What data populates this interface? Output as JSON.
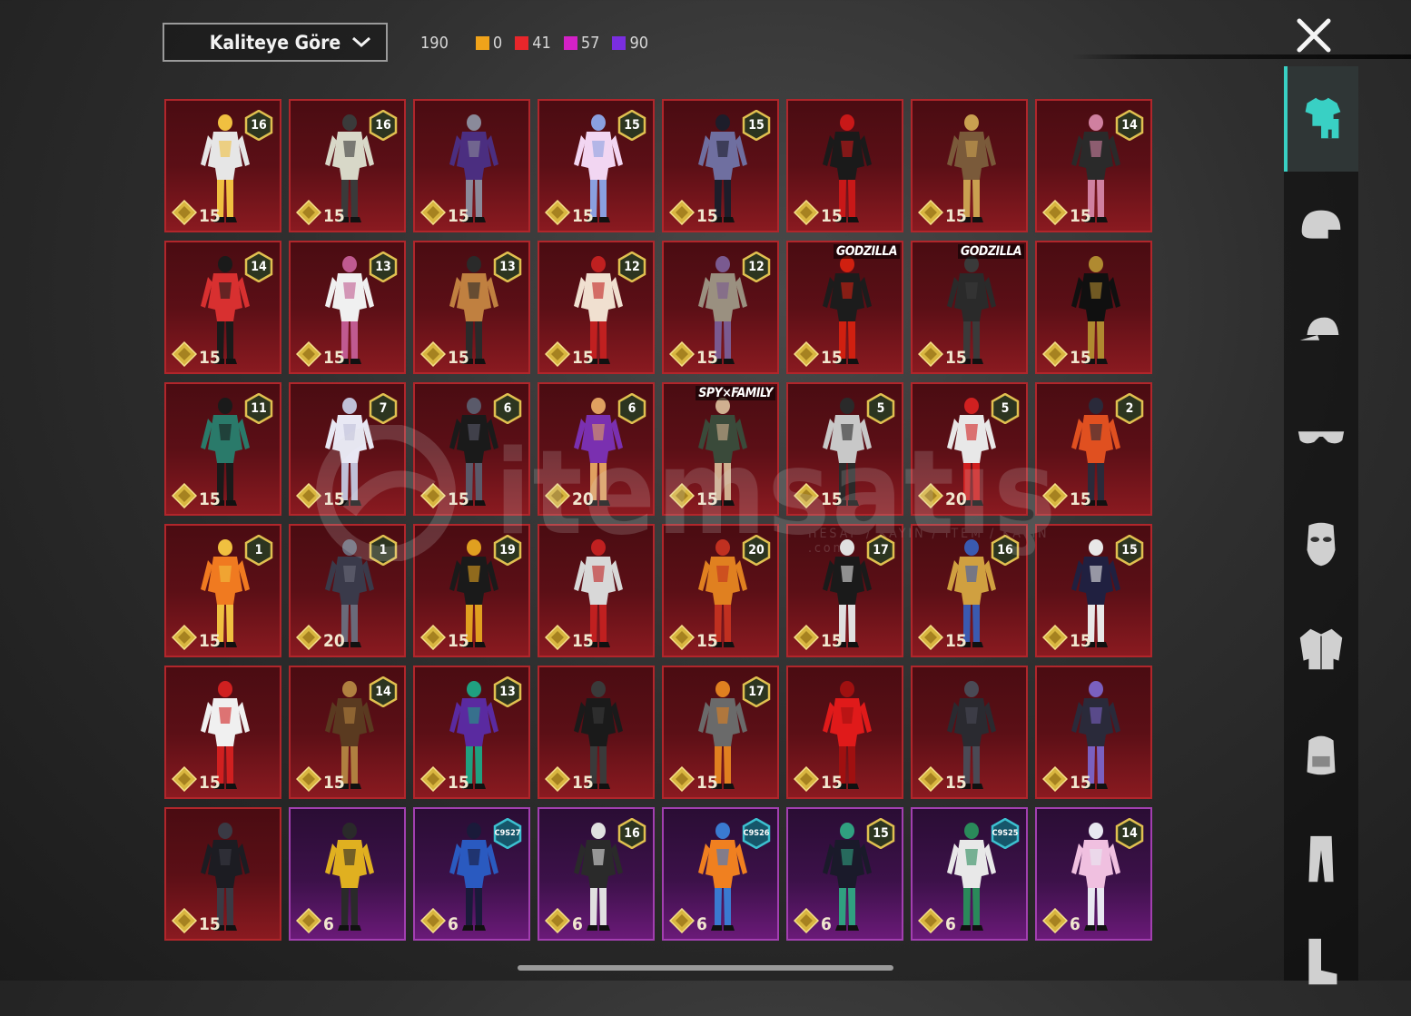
{
  "toolbar": {
    "sort_label": "Kaliteye Göre",
    "total": "190",
    "counts": [
      {
        "color": "#f0a31a",
        "value": "0"
      },
      {
        "color": "#e8262b",
        "value": "41"
      },
      {
        "color": "#d321c6",
        "value": "57"
      },
      {
        "color": "#7a2ee0",
        "value": "90"
      }
    ]
  },
  "watermark": {
    "text": "itemsatış",
    "sub": "HESAP / KAYIN / ITEM / KAYIN .com"
  },
  "sidebar": {
    "categories": [
      "outfit-icon",
      "helmet-icon",
      "cap-icon",
      "glasses-icon",
      "mask-icon",
      "jacket-icon",
      "backpack-icon",
      "pants-icon",
      "boots-icon"
    ],
    "active": 0
  },
  "items": [
    {
      "rank": "16",
      "price": "15",
      "tint": "red",
      "colors": [
        "#e6e6e6",
        "#f0c040"
      ]
    },
    {
      "rank": "16",
      "price": "15",
      "tint": "red",
      "colors": [
        "#d8d8c8",
        "#3a3a3a"
      ]
    },
    {
      "rank": "",
      "price": "15",
      "tint": "red",
      "colors": [
        "#4b2e80",
        "#8a8a9a"
      ]
    },
    {
      "rank": "15",
      "price": "15",
      "tint": "red",
      "colors": [
        "#f2d6f2",
        "#8aa0e0"
      ]
    },
    {
      "rank": "15",
      "price": "15",
      "tint": "red",
      "colors": [
        "#6f6fa0",
        "#1d1d2a"
      ]
    },
    {
      "rank": "",
      "price": "15",
      "tint": "red",
      "colors": [
        "#1a1a1a",
        "#c81818"
      ]
    },
    {
      "rank": "",
      "price": "15",
      "tint": "red",
      "colors": [
        "#7a5a3a",
        "#c9a050"
      ]
    },
    {
      "rank": "14",
      "price": "15",
      "tint": "red",
      "colors": [
        "#2a2a2a",
        "#d080a0"
      ]
    },
    {
      "rank": "14",
      "price": "15",
      "tint": "red",
      "colors": [
        "#d83030",
        "#1a1a1a"
      ]
    },
    {
      "rank": "13",
      "price": "15",
      "tint": "red",
      "colors": [
        "#f0f0f0",
        "#c05a90"
      ]
    },
    {
      "rank": "13",
      "price": "15",
      "tint": "red",
      "colors": [
        "#c08040",
        "#2a2a2a"
      ]
    },
    {
      "rank": "12",
      "price": "15",
      "tint": "red",
      "colors": [
        "#f0e0d0",
        "#c02020"
      ]
    },
    {
      "rank": "12",
      "price": "15",
      "tint": "red",
      "colors": [
        "#9a9080",
        "#7a5a90"
      ]
    },
    {
      "rank": "",
      "price": "15",
      "tint": "red",
      "banner": "GODZILLA",
      "colors": [
        "#1c1c1c",
        "#d02010"
      ]
    },
    {
      "rank": "",
      "price": "15",
      "tint": "red",
      "banner": "GODZILLA",
      "colors": [
        "#2a2a2a",
        "#3a3a3a"
      ]
    },
    {
      "rank": "",
      "price": "15",
      "tint": "red",
      "colors": [
        "#101010",
        "#b08a30"
      ]
    },
    {
      "rank": "11",
      "price": "15",
      "tint": "red",
      "colors": [
        "#2a7a6a",
        "#1a1a1a"
      ]
    },
    {
      "rank": "7",
      "price": "15",
      "tint": "red",
      "colors": [
        "#e8e8f4",
        "#c0c0d8"
      ]
    },
    {
      "rank": "6",
      "price": "15",
      "tint": "red",
      "colors": [
        "#1a1a1a",
        "#5a5a6a"
      ]
    },
    {
      "rank": "6",
      "price": "20",
      "tint": "red",
      "colors": [
        "#7a30b0",
        "#e0a060"
      ]
    },
    {
      "rank": "",
      "price": "15",
      "tint": "red",
      "banner": "SPY×FAMILY",
      "colors": [
        "#3a4a3a",
        "#d0b090"
      ]
    },
    {
      "rank": "5",
      "price": "15",
      "tint": "red",
      "colors": [
        "#c8c8c8",
        "#2a2a2a"
      ]
    },
    {
      "rank": "5",
      "price": "20",
      "tint": "red",
      "colors": [
        "#e8e8e8",
        "#d02020"
      ]
    },
    {
      "rank": "2",
      "price": "15",
      "tint": "red",
      "colors": [
        "#e05020",
        "#2a2a3a"
      ]
    },
    {
      "rank": "1",
      "price": "15",
      "tint": "red",
      "colors": [
        "#f07a20",
        "#f0c040"
      ]
    },
    {
      "rank": "1",
      "price": "20",
      "tint": "red",
      "colors": [
        "#3a3a4a",
        "#6a6a7a"
      ]
    },
    {
      "rank": "19",
      "price": "15",
      "tint": "red",
      "colors": [
        "#1a1a1a",
        "#e0a020"
      ]
    },
    {
      "rank": "",
      "price": "15",
      "tint": "red",
      "colors": [
        "#d8d8d8",
        "#c02020"
      ]
    },
    {
      "rank": "20",
      "price": "15",
      "tint": "red",
      "colors": [
        "#e08020",
        "#c03020"
      ]
    },
    {
      "rank": "17",
      "price": "15",
      "tint": "red",
      "colors": [
        "#1a1a1a",
        "#e0e0e0"
      ]
    },
    {
      "rank": "16",
      "price": "15",
      "tint": "red",
      "colors": [
        "#d0a040",
        "#3a5ab0"
      ]
    },
    {
      "rank": "15",
      "price": "15",
      "tint": "red",
      "colors": [
        "#202040",
        "#e8e8e8"
      ]
    },
    {
      "rank": "",
      "price": "15",
      "tint": "red",
      "colors": [
        "#f0f0f0",
        "#d02020"
      ]
    },
    {
      "rank": "14",
      "price": "15",
      "tint": "red",
      "colors": [
        "#5a3a20",
        "#b08040"
      ]
    },
    {
      "rank": "13",
      "price": "15",
      "tint": "red",
      "colors": [
        "#5a2aa0",
        "#20a080"
      ]
    },
    {
      "rank": "",
      "price": "15",
      "tint": "red",
      "colors": [
        "#1a1a1a",
        "#3a3a3a"
      ]
    },
    {
      "rank": "17",
      "price": "15",
      "tint": "red",
      "colors": [
        "#6a6a6a",
        "#e08020"
      ]
    },
    {
      "rank": "",
      "price": "15",
      "tint": "red",
      "colors": [
        "#e01a1a",
        "#a01010"
      ]
    },
    {
      "rank": "",
      "price": "15",
      "tint": "red",
      "colors": [
        "#2a2a30",
        "#4a4a55"
      ]
    },
    {
      "rank": "",
      "price": "15",
      "tint": "red",
      "colors": [
        "#2a2a3a",
        "#7a60c0"
      ]
    },
    {
      "rank": "",
      "price": "15",
      "tint": "red",
      "colors": [
        "#1c1c22",
        "#3a3a44"
      ]
    },
    {
      "rank": "",
      "price": "6",
      "tint": "purple",
      "colors": [
        "#e0b020",
        "#2a2a2a"
      ]
    },
    {
      "rank": "C9S27",
      "price": "6",
      "tint": "purple",
      "colors": [
        "#2a5ac0",
        "#1a1a3a"
      ]
    },
    {
      "rank": "16",
      "price": "6",
      "tint": "purple",
      "colors": [
        "#2a2a2a",
        "#e0e0e0"
      ]
    },
    {
      "rank": "C9S26",
      "price": "6",
      "tint": "purple",
      "colors": [
        "#f08020",
        "#3a7ad0"
      ]
    },
    {
      "rank": "15",
      "price": "6",
      "tint": "purple",
      "colors": [
        "#1a1a2a",
        "#30a080"
      ]
    },
    {
      "rank": "C9S25",
      "price": "6",
      "tint": "purple",
      "colors": [
        "#e8e8e8",
        "#2a8a5a"
      ]
    },
    {
      "rank": "14",
      "price": "6",
      "tint": "purple",
      "colors": [
        "#f0c0e0",
        "#e8e8f0"
      ]
    }
  ]
}
